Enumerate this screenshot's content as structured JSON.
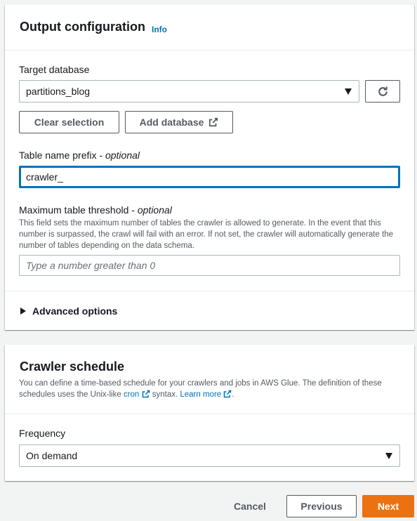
{
  "output_config": {
    "title": "Output configuration",
    "info_label": "Info",
    "target_database": {
      "label": "Target database",
      "value": "partitions_blog",
      "refresh_icon": "refresh-icon"
    },
    "buttons": {
      "clear_selection": "Clear selection",
      "add_database": "Add database"
    },
    "table_prefix": {
      "label": "Table name prefix",
      "optional": "optional",
      "value": "crawler_"
    },
    "max_threshold": {
      "label": "Maximum table threshold",
      "optional": "optional",
      "description": "This field sets the maximum number of tables the crawler is allowed to generate. In the event that this number is surpassed, the crawl will fail with an error. If not set, the crawler will automatically generate the number of tables depending on the data schema.",
      "placeholder": "Type a number greater than 0"
    },
    "advanced_options": "Advanced options"
  },
  "crawler_schedule": {
    "title": "Crawler schedule",
    "description_before": "You can define a time-based schedule for your crawlers and jobs in AWS Glue. The definition of these schedules uses the Unix-like",
    "cron_link": "cron",
    "description_middle": "syntax.",
    "learn_more_link": "Learn more",
    "description_end": ".",
    "frequency": {
      "label": "Frequency",
      "value": "On demand"
    }
  },
  "footer": {
    "cancel": "Cancel",
    "previous": "Previous",
    "next": "Next"
  },
  "colors": {
    "accent": "#0073bb",
    "primary_button": "#ec7211",
    "text": "#16191f",
    "secondary_text": "#545b64"
  }
}
